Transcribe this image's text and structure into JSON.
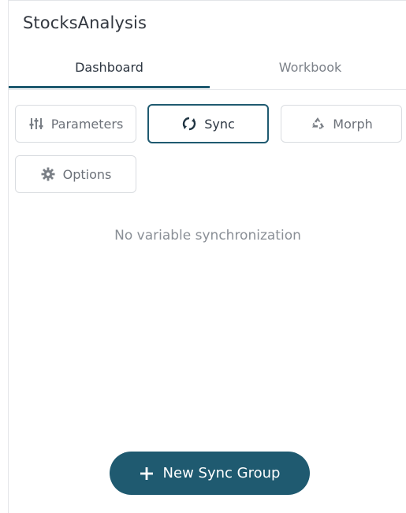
{
  "header": {
    "title": "StocksAnalysis"
  },
  "tabs": [
    {
      "label": "Dashboard",
      "active": true
    },
    {
      "label": "Workbook",
      "active": false
    }
  ],
  "toolbar": {
    "parameters_label": "Parameters",
    "sync_label": "Sync",
    "morph_label": "Morph",
    "options_label": "Options",
    "active": "Sync",
    "icons": {
      "parameters": "sliders-icon",
      "sync": "sync-icon",
      "morph": "recycle-icon",
      "options": "gear-icon"
    }
  },
  "content": {
    "empty_message": "No variable synchronization"
  },
  "actions": {
    "new_sync_group_label": "New Sync Group",
    "new_sync_group_icon": "plus-icon"
  },
  "colors": {
    "accent": "#1f5a70",
    "text_muted": "#8a8f96",
    "border": "#d9dce0"
  }
}
